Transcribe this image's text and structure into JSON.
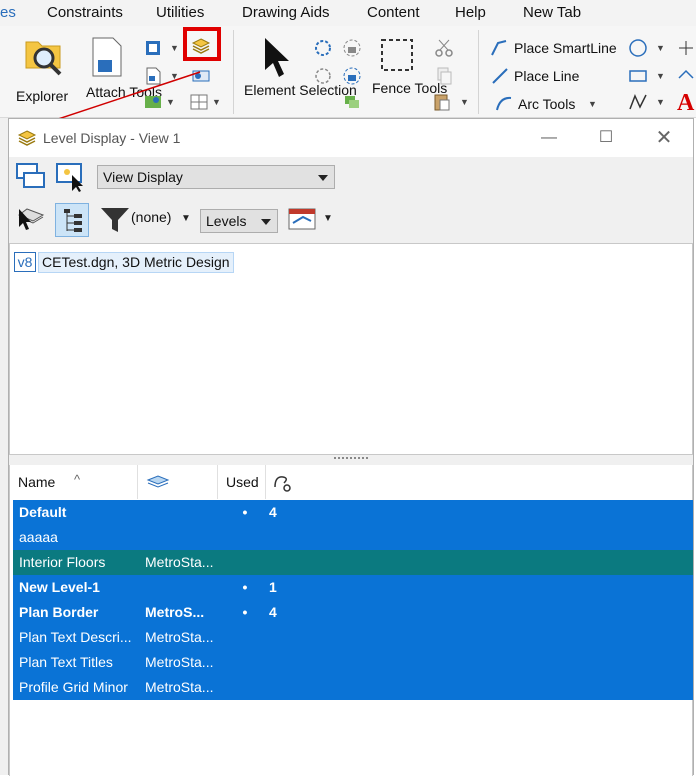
{
  "menubar": {
    "items": [
      "es",
      "Constraints",
      "Utilities",
      "Drawing Aids",
      "Content",
      "Help",
      "New Tab"
    ]
  },
  "ribbon": {
    "explorer_label": "Explorer",
    "attach_tools_label": "Attach Tools",
    "element_selection_label": "Element Selection",
    "fence_tools_label": "Fence Tools",
    "place_smartline_label": "Place SmartLine",
    "place_line_label": "Place Line",
    "arc_tools_label": "Arc Tools",
    "text_glyph": "A"
  },
  "dialog": {
    "title": "Level Display - View 1",
    "view_display_value": "View Display",
    "filter_value": "(none)",
    "levels_value": "Levels",
    "tree": {
      "badge": "v8",
      "label": "CETest.dgn, 3D Metric Design"
    },
    "columns": {
      "name": "Name",
      "sort_glyph": "^",
      "used": "Used"
    },
    "rows": [
      {
        "name": "Default",
        "model": "",
        "used": "•",
        "count": "4",
        "bold": true,
        "alt": false
      },
      {
        "name": "aaaaa",
        "model": "",
        "used": "",
        "count": "",
        "bold": false,
        "alt": false
      },
      {
        "name": "Interior Floors",
        "model": "MetroSta...",
        "used": "",
        "count": "",
        "bold": false,
        "alt": true
      },
      {
        "name": "New Level-1",
        "model": "",
        "used": "•",
        "count": "1",
        "bold": true,
        "alt": false
      },
      {
        "name": "Plan Border",
        "model": "MetroS...",
        "used": "•",
        "count": "4",
        "bold": true,
        "alt": false
      },
      {
        "name": "Plan Text Descri...",
        "model": "MetroSta...",
        "used": "",
        "count": "",
        "bold": false,
        "alt": false
      },
      {
        "name": "Plan Text Titles",
        "model": "MetroSta...",
        "used": "",
        "count": "",
        "bold": false,
        "alt": false
      },
      {
        "name": "Profile Grid Minor",
        "model": "MetroSta...",
        "used": "",
        "count": "",
        "bold": false,
        "alt": false
      }
    ]
  },
  "colors": {
    "selection_blue": "#0a73d6",
    "selection_teal": "#0b7a80",
    "highlight_red": "#e00000"
  },
  "icons": {
    "explorer": "folder-search-icon",
    "attach": "document-attach-icon",
    "level_display": "layers-icon",
    "element_selection": "cursor-arrow-icon",
    "fence": "dashed-rectangle-icon",
    "filter": "funnel-icon",
    "circle": "circle-icon",
    "rectangle": "rectangle-icon",
    "close": "close-icon"
  }
}
